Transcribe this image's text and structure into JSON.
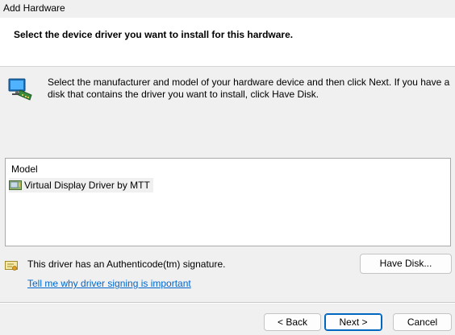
{
  "window": {
    "title": "Add Hardware"
  },
  "header": {
    "text": "Select the device driver you want to install for this hardware."
  },
  "instructions": {
    "text": "Select the manufacturer and model of your hardware device and then click Next. If you have a disk that contains the driver you want to install, click Have Disk."
  },
  "model_list": {
    "header": "Model",
    "items": [
      {
        "label": "Virtual Display Driver by MTT",
        "selected": true
      }
    ]
  },
  "signature": {
    "text": "This driver has an Authenticode(tm) signature.",
    "link": "Tell me why driver signing is important"
  },
  "buttons": {
    "have_disk": "Have Disk...",
    "back": "< Back",
    "next": "Next >",
    "cancel": "Cancel"
  },
  "colors": {
    "link": "#0066cc",
    "primary_border": "#0067c0",
    "background": "#f0f0f0"
  }
}
